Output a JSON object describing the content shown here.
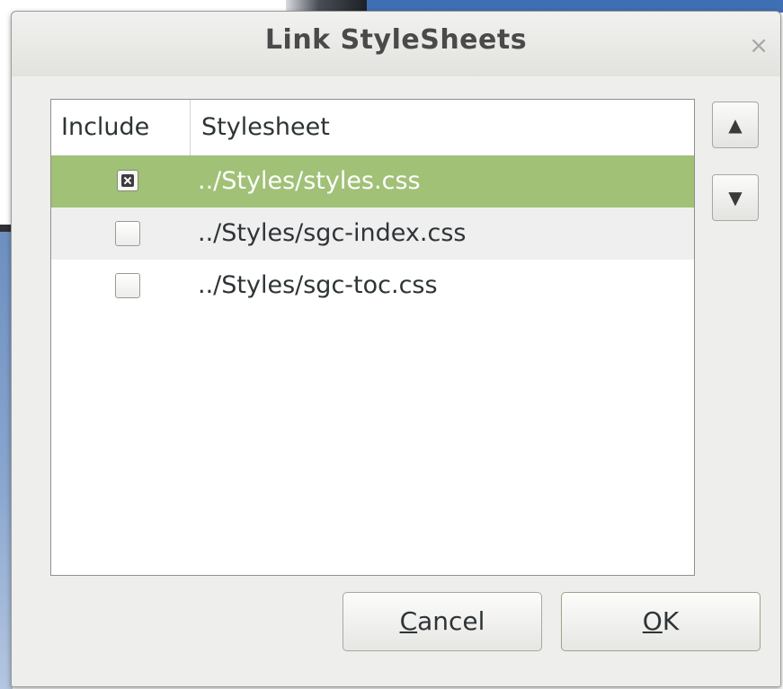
{
  "dialog": {
    "title": "Link StyleSheets",
    "close_glyph": "×"
  },
  "list": {
    "columns": [
      {
        "label": "Include"
      },
      {
        "label": "Stylesheet"
      }
    ],
    "rows": [
      {
        "include": true,
        "path": "../Styles/styles.css",
        "selected": true
      },
      {
        "include": false,
        "path": "../Styles/sgc-index.css",
        "selected": false
      },
      {
        "include": false,
        "path": "../Styles/sgc-toc.css",
        "selected": false
      }
    ]
  },
  "side_buttons": {
    "up_glyph": "▲",
    "down_glyph": "▼"
  },
  "buttons": {
    "cancel": {
      "mnemonic": "C",
      "rest": "ancel"
    },
    "ok": {
      "mnemonic": "O",
      "rest": "K"
    }
  },
  "colors": {
    "selection": "#a1c177",
    "dialog_bg": "#eeeeec"
  },
  "icons": {
    "close": "close-icon",
    "move_up": "arrow-up-icon",
    "move_down": "arrow-down-icon",
    "checkbox_checked": "checkbox-checked-icon",
    "checkbox_unchecked": "checkbox-unchecked-icon"
  }
}
